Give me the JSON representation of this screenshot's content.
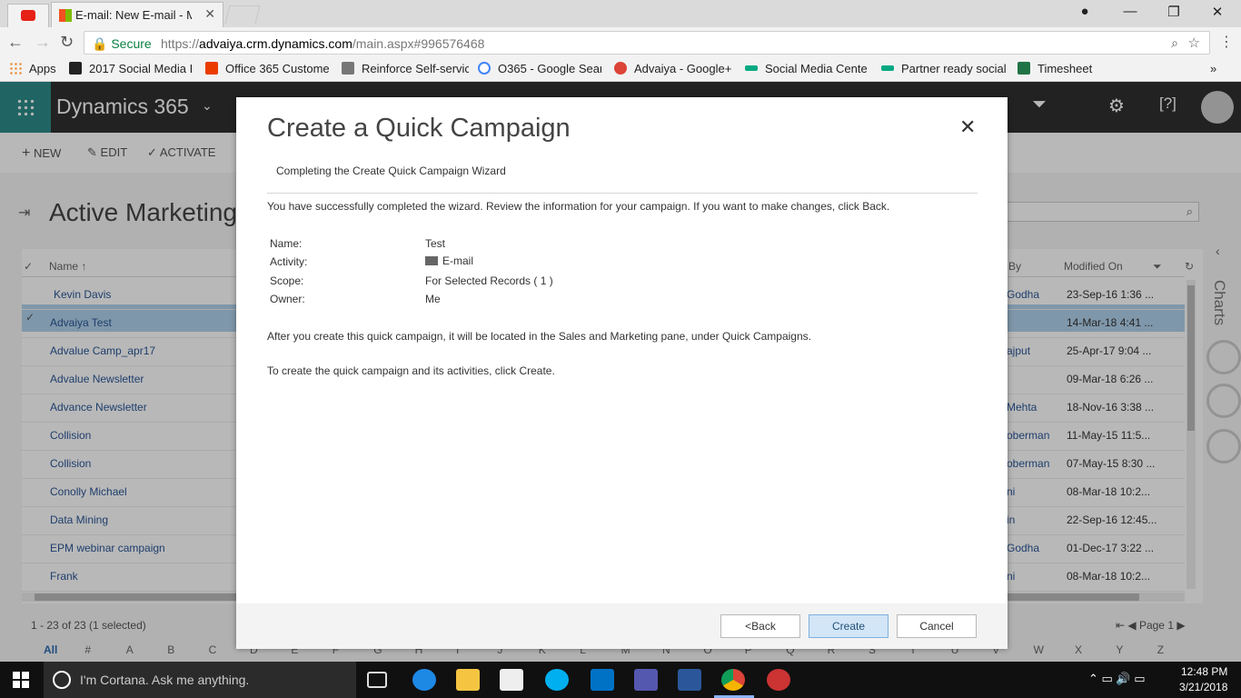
{
  "browser": {
    "active_tab_title": "E-mail: New E-mail - M",
    "secure_label": "Secure",
    "url_prefix": "https://",
    "url_host": "advaiya.crm.dynamics.com",
    "url_path": "/main.aspx#996576468",
    "bookmarks": [
      {
        "label": "Apps",
        "icon_color": "#e8710a"
      },
      {
        "label": "2017 Social Media I",
        "icon_color": "#222222"
      },
      {
        "label": "Office 365 Custome",
        "icon_color": "#eb3c00"
      },
      {
        "label": "Reinforce Self-servic",
        "icon_color": "#555555"
      },
      {
        "label": "O365 - Google Sear",
        "icon_color": "#4285f4"
      },
      {
        "label": "Advaiya - Google+",
        "icon_color": "#db4437"
      },
      {
        "label": "Social Media Cente",
        "icon_color": "#01a982"
      },
      {
        "label": "Partner ready social",
        "icon_color": "#01a982"
      },
      {
        "label": "Timesheet",
        "icon_color": "#217346"
      }
    ]
  },
  "app": {
    "title": "Dynamics 365",
    "commands": [
      "NEW",
      "EDIT",
      "ACTIVATE"
    ],
    "view_title": "Active Marketing"
  },
  "grid": {
    "header_name": "Name",
    "header_by": "By",
    "header_modified": "Modified On",
    "rows": [
      {
        "name": "Kevin Davis",
        "by": "Godha",
        "modified": "23-Sep-16 1:36 ..."
      },
      {
        "name": "Advaiya Test",
        "by": "",
        "modified": "14-Mar-18 4:41 ..."
      },
      {
        "name": "Advalue Camp_apr17",
        "by": "ajput",
        "modified": "25-Apr-17 9:04 ..."
      },
      {
        "name": "Advalue Newsletter",
        "by": "",
        "modified": "09-Mar-18 6:26 ..."
      },
      {
        "name": "Advance Newsletter",
        "by": "Mehta",
        "modified": "18-Nov-16 3:38 ..."
      },
      {
        "name": "Collision",
        "by": "oberman",
        "modified": "11-May-15 11:5..."
      },
      {
        "name": "Collision",
        "by": "oberman",
        "modified": "07-May-15 8:30 ..."
      },
      {
        "name": "Conolly Michael",
        "by": "ni",
        "modified": "08-Mar-18 10:2..."
      },
      {
        "name": "Data Mining",
        "by": "in",
        "modified": "22-Sep-16 12:45..."
      },
      {
        "name": "EPM webinar campaign",
        "by": "Godha",
        "modified": "01-Dec-17 3:22 ..."
      },
      {
        "name": "Frank",
        "by": "ni",
        "modified": "08-Mar-18 10:2..."
      }
    ],
    "status": "1 - 23 of 23 (1 selected)",
    "page_label": "Page 1",
    "alphabet": [
      "All",
      "#",
      "A",
      "B",
      "C",
      "D",
      "E",
      "F",
      "G",
      "H",
      "I",
      "J",
      "K",
      "L",
      "M",
      "N",
      "O",
      "P",
      "Q",
      "R",
      "S",
      "T",
      "U",
      "V",
      "W",
      "X",
      "Y",
      "Z"
    ],
    "charts_label": "Charts"
  },
  "dialog": {
    "title": "Create a Quick Campaign",
    "subtitle": "Completing the Create Quick Campaign Wizard",
    "intro": "You have successfully completed the wizard. Review the information for your campaign. If you want to make changes, click Back.",
    "fields": [
      {
        "label": "Name:",
        "value": "Test"
      },
      {
        "label": "Activity:",
        "value": "E-mail"
      },
      {
        "label": "Scope:",
        "value": "For Selected Records ( 1 )"
      },
      {
        "label": "Owner:",
        "value": "Me"
      }
    ],
    "para1": "After you create this quick campaign, it will be located in the Sales and Marketing pane, under Quick Campaigns.",
    "para2": "To create the quick campaign and its activities, click Create.",
    "back_label": "<Back",
    "create_label": "Create",
    "cancel_label": "Cancel"
  },
  "taskbar": {
    "cortana_placeholder": "I'm Cortana. Ask me anything.",
    "time": "12:48 PM",
    "date": "3/21/2018"
  }
}
